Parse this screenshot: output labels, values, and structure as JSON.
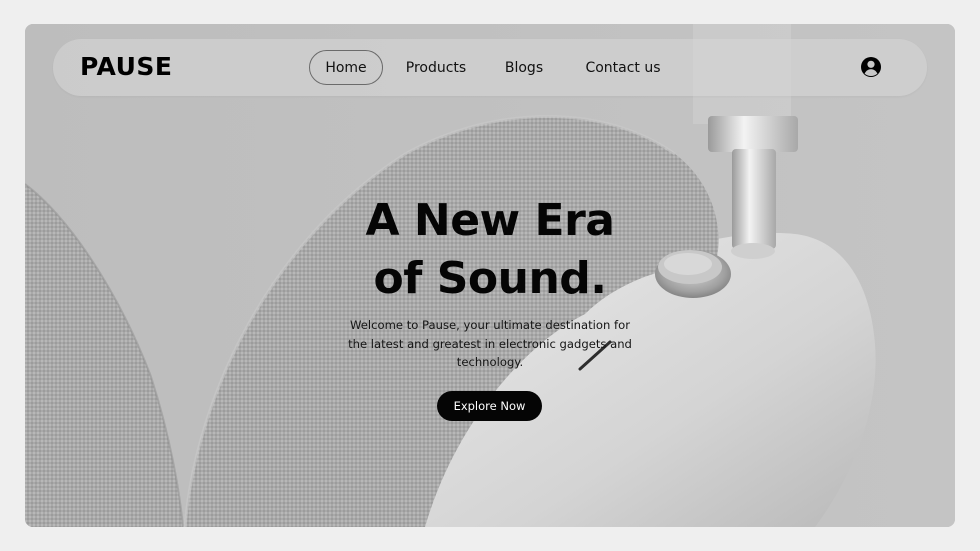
{
  "brand": {
    "name": "PAUSE"
  },
  "nav": {
    "items": [
      {
        "label": "Home",
        "active": true
      },
      {
        "label": "Products",
        "active": false
      },
      {
        "label": "Blogs",
        "active": false
      },
      {
        "label": "Contact us",
        "active": false
      }
    ],
    "account_icon": "user-circle-icon"
  },
  "hero": {
    "title_line1": "A New Era",
    "title_line2": "of Sound.",
    "description": "Welcome to Pause, your ultimate destination for the latest and greatest in electronic gadgets and technology.",
    "cta_label": "Explore Now"
  },
  "colors": {
    "page_bg": "#efefef",
    "hero_bg": "#bdbdbd",
    "text": "#050505",
    "cta_bg": "#050505",
    "cta_text": "#ffffff"
  }
}
